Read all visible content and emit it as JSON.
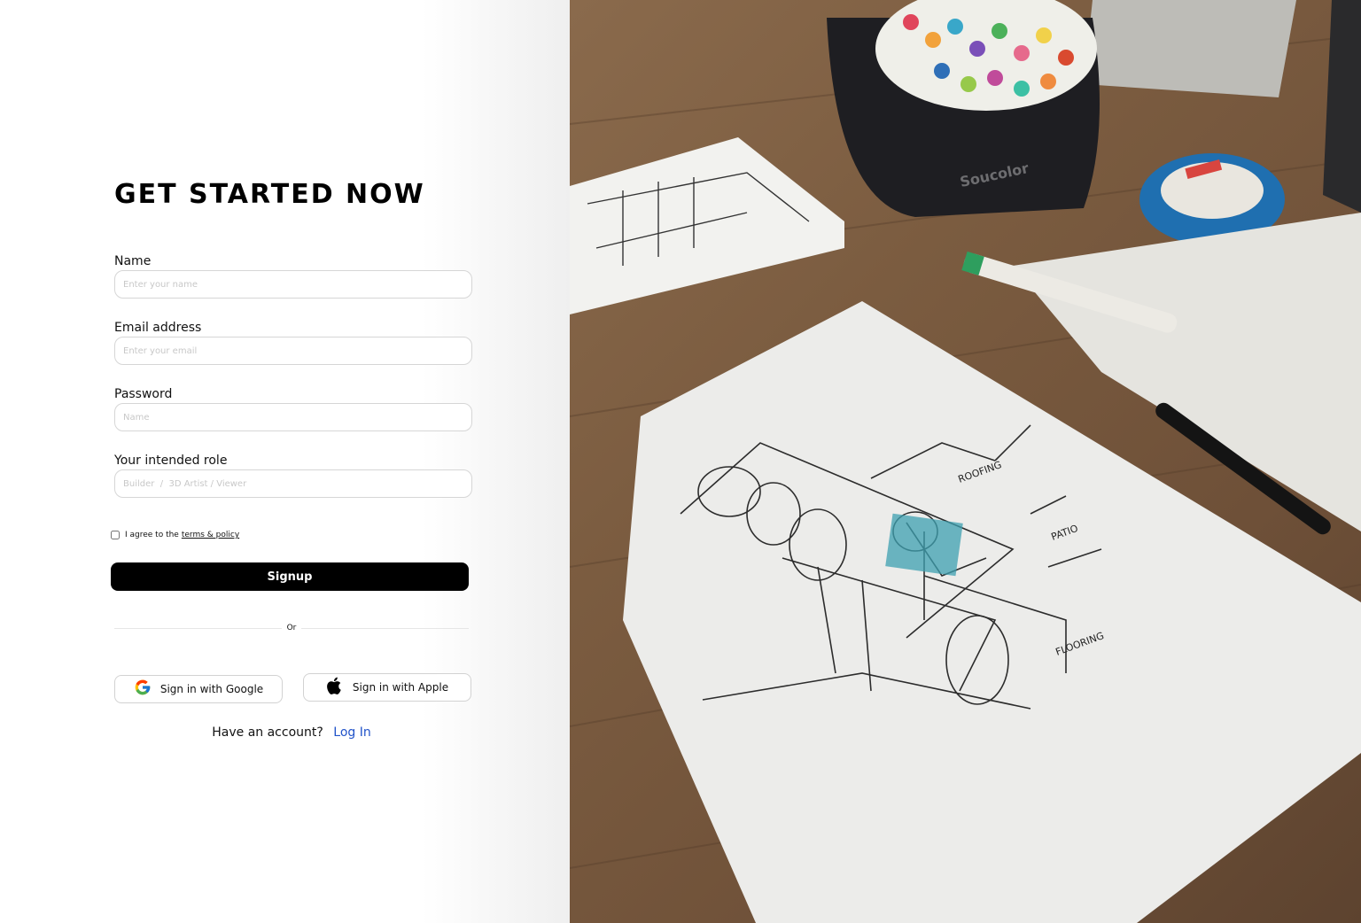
{
  "header": {
    "title": "GET STARTED NOW"
  },
  "form": {
    "name": {
      "label": "Name",
      "placeholder": "Enter your name"
    },
    "email": {
      "label": "Email address",
      "placeholder": "Enter your email"
    },
    "password": {
      "label": "Password",
      "placeholder": "Name"
    },
    "role": {
      "label": "Your intended role",
      "placeholder": "Builder  /  3D Artist / Viewer"
    },
    "terms": {
      "text": "I agree to the",
      "link": "terms & policy",
      "checked": false
    },
    "signup_label": "Signup"
  },
  "divider": {
    "text": "Or"
  },
  "social": {
    "google_label": "Sign in with Google",
    "apple_label": "Sign in with Apple",
    "google_icon": "google-icon",
    "apple_icon": "apple-icon"
  },
  "footer": {
    "prompt": "Have an account?",
    "login_label": "Log In"
  },
  "hero": {
    "marker_brand": "Soucolor",
    "sketch_notes": [
      "ROOFING",
      "PATIO",
      "FLOORING"
    ]
  },
  "colors": {
    "primary": "#000000",
    "link": "#2153c9",
    "input_border": "#d6d6d6",
    "wood": "#7b5c40",
    "tape": "#1f6fb0"
  }
}
